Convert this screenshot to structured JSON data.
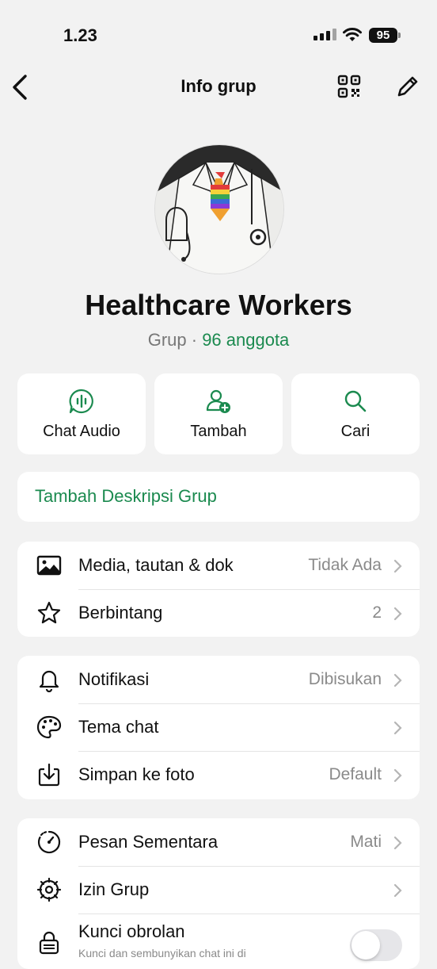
{
  "status": {
    "time": "1.23",
    "battery": "95"
  },
  "nav": {
    "title": "Info grup"
  },
  "group": {
    "name": "Healthcare Workers",
    "type": "Grup",
    "separator": " · ",
    "members": "96 anggota"
  },
  "actions": [
    {
      "label": "Chat Audio",
      "icon": "audio-chat-icon"
    },
    {
      "label": "Tambah",
      "icon": "add-person-icon"
    },
    {
      "label": "Cari",
      "icon": "search-icon"
    }
  ],
  "description": {
    "label": "Tambah Deskripsi Grup"
  },
  "section1": [
    {
      "title": "Media, tautan & dok",
      "value": "Tidak Ada",
      "icon": "image-icon"
    },
    {
      "title": "Berbintang",
      "value": "2",
      "icon": "star-icon"
    }
  ],
  "section2": [
    {
      "title": "Notifikasi",
      "value": "Dibisukan",
      "icon": "bell-icon"
    },
    {
      "title": "Tema chat",
      "value": "",
      "icon": "palette-icon"
    },
    {
      "title": "Simpan ke foto",
      "value": "Default",
      "icon": "download-icon"
    }
  ],
  "section3": [
    {
      "title": "Pesan Sementara",
      "value": "Mati",
      "icon": "timer-icon"
    },
    {
      "title": "Izin Grup",
      "value": "",
      "icon": "settings-gear-icon"
    },
    {
      "title": "Kunci obrolan",
      "subtitle": "Kunci dan sembunyikan chat ini di",
      "icon": "lock-icon",
      "toggle": false
    }
  ],
  "colors": {
    "accent": "#1b8a4f",
    "background": "#f2f2f2",
    "card": "#ffffff",
    "secondary_text": "#8a8a8a"
  }
}
